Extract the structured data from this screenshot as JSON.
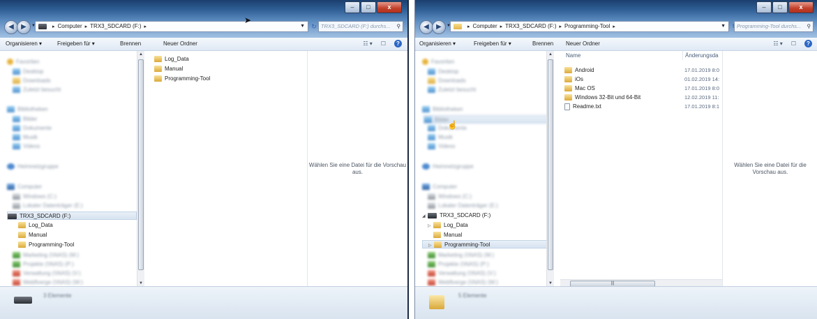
{
  "left": {
    "caption": {
      "minimize": "–",
      "maximize": "□",
      "close": "x"
    },
    "breadcrumb": [
      "Computer",
      "TRX3_SDCARD (F:)"
    ],
    "search_placeholder": "TRX3_SDCARD (F:) durchs...",
    "toolbar": {
      "organize": "Organisieren ▾",
      "share": "Freigeben für ▾",
      "burn": "Brennen",
      "new_folder": "Neuer Ordner"
    },
    "nav_blurred": {
      "favorites": "Favoriten",
      "desktop": "Desktop",
      "downloads": "Downloads",
      "recent": "Zuletzt besucht",
      "libraries": "Bibliotheken",
      "pictures": "Bilder",
      "documents": "Dokumente",
      "music": "Musik",
      "videos": "Videos",
      "homegroup": "Heimnetzgruppe",
      "computer": "Computer",
      "windows_c": "Windows (C:)",
      "drive_e": "Lokaler Datenträger (E:)",
      "net1": "Marketing (\\\\NAS) (M:)",
      "net2": "Projekte (\\\\NAS) (P:)",
      "net3": "Verwaltung (\\\\NAS) (V:)",
      "net4": "Webflverge (\\\\NAS) (W:)"
    },
    "nav_drive": "TRX3_SDCARD (F:)",
    "nav_children": [
      "Log_Data",
      "Manual",
      "Programming-Tool"
    ],
    "files": [
      "Log_Data",
      "Manual",
      "Programming-Tool"
    ],
    "preview_text": "Wählen Sie eine Datei für die Vorschau aus.",
    "details_text": "3 Elemente"
  },
  "right": {
    "caption": {
      "minimize": "–",
      "maximize": "□",
      "close": "x"
    },
    "breadcrumb": [
      "Computer",
      "TRX3_SDCARD (F:)",
      "Programming-Tool"
    ],
    "search_placeholder": "Programming-Tool durchs...",
    "toolbar": {
      "organize": "Organisieren ▾",
      "share": "Freigeben für ▾",
      "burn": "Brennen",
      "new_folder": "Neuer Ordner"
    },
    "nav_blurred": {
      "favorites": "Favoriten",
      "desktop": "Desktop",
      "downloads": "Downloads",
      "recent": "Zuletzt besucht",
      "libraries": "Bibliotheken",
      "pictures": "Bilder",
      "documents": "Dokumente",
      "music": "Musik",
      "videos": "Videos",
      "homegroup": "Heimnetzgruppe",
      "computer": "Computer",
      "windows_c": "Windows (C:)",
      "drive_e": "Lokaler Datenträger (E:)",
      "net1": "Marketing (\\\\NAS) (M:)",
      "net2": "Projekte (\\\\NAS) (P:)",
      "net3": "Verwaltung (\\\\NAS) (V:)",
      "net4": "Webflverge (\\\\NAS) (W:)"
    },
    "nav_drive": "TRX3_SDCARD (F:)",
    "nav_children": [
      "Log_Data",
      "Manual",
      "Programming-Tool"
    ],
    "columns": {
      "name": "Name",
      "modified": "Änderungsda"
    },
    "files": [
      {
        "name": "Android",
        "date": "17.01.2019 8:0"
      },
      {
        "name": "iOs",
        "date": "01.02.2019 14:"
      },
      {
        "name": "Mac OS",
        "date": "17.01.2019 8:0"
      },
      {
        "name": "Windows 32-Bit und 64-Bit",
        "date": "12.02.2019 11:"
      },
      {
        "name": "Readme.txt",
        "date": "17.01.2019 8:1"
      }
    ],
    "preview_text": "Wählen Sie eine Datei für die Vorschau aus.",
    "details_text": "5 Elemente"
  },
  "icons": {
    "back": "back-arrow-icon",
    "forward": "forward-arrow-icon",
    "search": "search-icon",
    "help": "help-icon",
    "folder": "folder-icon"
  }
}
